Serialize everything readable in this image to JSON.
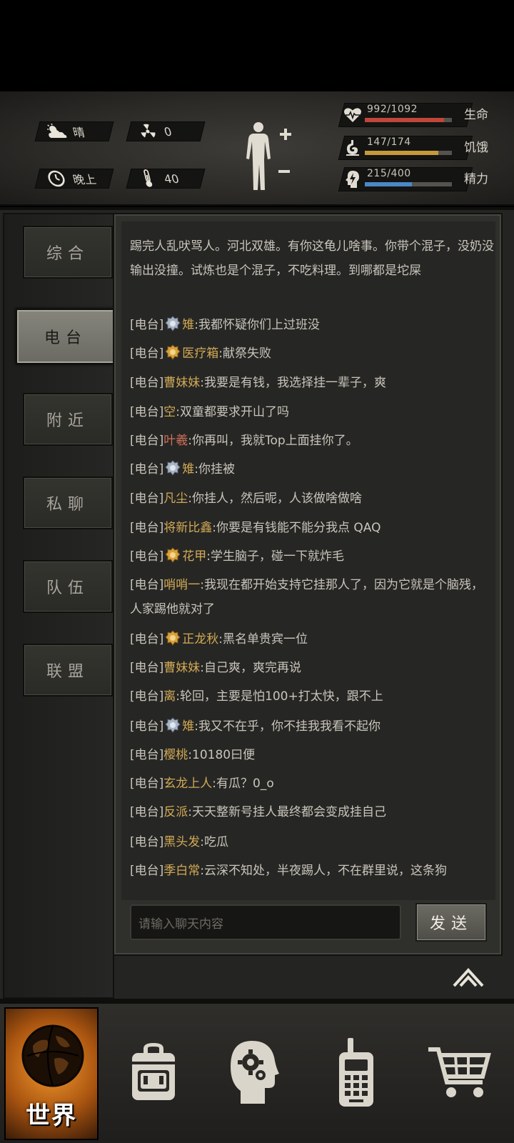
{
  "status": {
    "weather": {
      "icon": "partly-cloudy-icon",
      "label": "晴"
    },
    "radiation": {
      "icon": "radiation-icon",
      "value": "0"
    },
    "time": {
      "icon": "clock-icon",
      "label": "晚上"
    },
    "temperature": {
      "icon": "thermometer-icon",
      "value": "40"
    },
    "stats": [
      {
        "key": "health",
        "icon": "heartbeat-icon",
        "value": "992/1092",
        "label": "生命",
        "ratio": 0.908,
        "color": "#c0463a"
      },
      {
        "key": "hunger",
        "icon": "stomach-icon",
        "value": "147/174",
        "label": "饥饿",
        "ratio": 0.845,
        "color": "#c59a3c"
      },
      {
        "key": "energy",
        "icon": "lightning-head-icon",
        "value": "215/400",
        "label": "精力",
        "ratio": 0.5375,
        "color": "#4a88c8"
      }
    ]
  },
  "tabs": [
    {
      "label": "综合",
      "active": false
    },
    {
      "label": "电台",
      "active": true
    },
    {
      "label": "附近",
      "active": false
    },
    {
      "label": "私聊",
      "active": false
    },
    {
      "label": "队伍",
      "active": false
    },
    {
      "label": "联盟",
      "active": false
    }
  ],
  "chat": {
    "messages": [
      {
        "channel": "",
        "badge": "",
        "name": "",
        "name_color": "",
        "text": "踢完人乱吠骂人。河北双雄。有你这龟儿啥事。你带个混子，没奶没输出没撞。试炼也是个混子，不吃料理。到哪都是坨屎"
      },
      {
        "channel": "[电台]",
        "badge": "silver",
        "name": "雉",
        "name_color": "gold",
        "text": "我都怀疑你们上过班没"
      },
      {
        "channel": "[电台]",
        "badge": "gold",
        "name": "医疗箱",
        "name_color": "gold",
        "text": "献祭失败"
      },
      {
        "channel": "[电台]",
        "badge": "",
        "name": "曹妹妹",
        "name_color": "gold",
        "text": "我要是有钱，我选择挂一辈子，爽"
      },
      {
        "channel": "[电台]",
        "badge": "",
        "name": "空",
        "name_color": "gold",
        "text": "双童都要求开山了吗"
      },
      {
        "channel": "[电台]",
        "badge": "",
        "name": "叶羲",
        "name_color": "red",
        "text": "你再叫，我就Top上面挂你了。"
      },
      {
        "channel": "[电台]",
        "badge": "silver",
        "name": "雉",
        "name_color": "gold",
        "text": "你挂被"
      },
      {
        "channel": "[电台]",
        "badge": "",
        "name": "凡尘",
        "name_color": "gold",
        "text": "你挂人，然后呢，人该做啥做啥"
      },
      {
        "channel": "[电台]",
        "badge": "",
        "name": "将新比鑫",
        "name_color": "gold",
        "text": "你要是有钱能不能分我点 QAQ"
      },
      {
        "channel": "[电台]",
        "badge": "gold",
        "name": "花甲",
        "name_color": "gold",
        "text": "学生脑子，碰一下就炸毛"
      },
      {
        "channel": "[电台]",
        "badge": "",
        "name": "哨哨一",
        "name_color": "gold",
        "text": "我现在都开始支持它挂那人了，因为它就是个脑残，人家踢他就对了"
      },
      {
        "channel": "[电台]",
        "badge": "gold",
        "name": "正龙秋",
        "name_color": "gold",
        "text": "黑名单贵宾一位"
      },
      {
        "channel": "[电台]",
        "badge": "",
        "name": "曹妹妹",
        "name_color": "gold",
        "text": "自己爽，爽完再说"
      },
      {
        "channel": "[电台]",
        "badge": "",
        "name": "离",
        "name_color": "gold",
        "text": "轮回，主要是怕100+打太快，跟不上"
      },
      {
        "channel": "[电台]",
        "badge": "silver",
        "name": "雉",
        "name_color": "gold",
        "text": "我又不在乎，你不挂我我看不起你"
      },
      {
        "channel": "[电台]",
        "badge": "",
        "name": "樱桃",
        "name_color": "gold",
        "text": "10180曰便"
      },
      {
        "channel": "[电台]",
        "badge": "",
        "name": "玄龙上人",
        "name_color": "gold",
        "text": "有瓜？0_o"
      },
      {
        "channel": "[电台]",
        "badge": "",
        "name": "反派",
        "name_color": "gold",
        "text": "天天整新号挂人最终都会变成挂自己"
      },
      {
        "channel": "[电台]",
        "badge": "",
        "name": "黑头发",
        "name_color": "gold",
        "text": "吃瓜"
      },
      {
        "channel": "[电台]",
        "badge": "",
        "name": "季白常",
        "name_color": "gold",
        "text": "云深不知处，半夜踢人，不在群里说，这条狗"
      }
    ],
    "input_placeholder": "请输入聊天内容",
    "send_label": "发送"
  },
  "bottom_nav": {
    "world_label": "世界",
    "items": [
      "globe-icon",
      "backpack-icon",
      "brain-gear-icon",
      "walkie-talkie-icon",
      "shopping-cart-icon"
    ]
  }
}
